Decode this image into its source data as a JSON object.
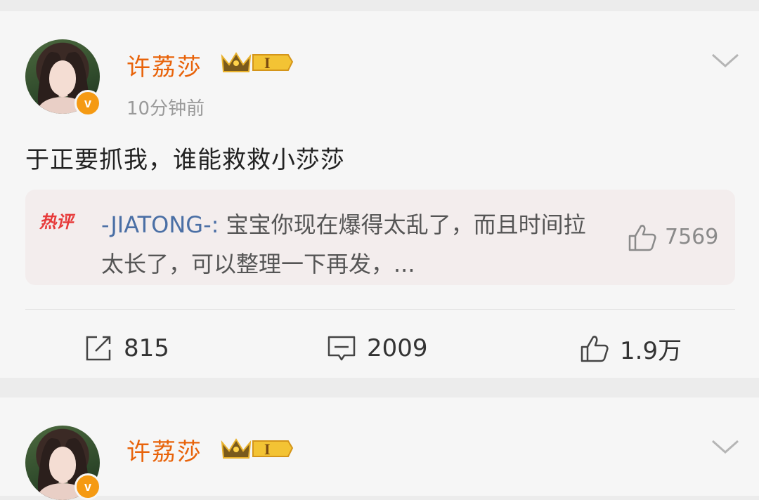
{
  "post1": {
    "username": "许荔莎",
    "level_badge": "I",
    "time": "10分钟前",
    "content": "于正要抓我，谁能救救小莎莎",
    "hot_comment": {
      "tag": "热评",
      "user": "-JIATONG-",
      "text": "宝宝你现在爆得太乱了，而且时间拉太长了，可以整理一下再发，...",
      "likes": "7569"
    },
    "actions": {
      "reposts": "815",
      "comments": "2009",
      "likes": "1.9万"
    }
  },
  "post2": {
    "username": "许荔莎",
    "level_badge": "I"
  },
  "icons": {
    "verified": "verified-badge-icon",
    "crown": "crown-icon",
    "more": "chevron-down-icon",
    "repost": "repost-icon",
    "comment": "comment-icon",
    "like": "thumb-up-icon"
  },
  "colors": {
    "username": "#e8630a",
    "verified": "#f59a13",
    "hot_tag": "#e73a3a",
    "hot_user": "#4a6fa5"
  }
}
